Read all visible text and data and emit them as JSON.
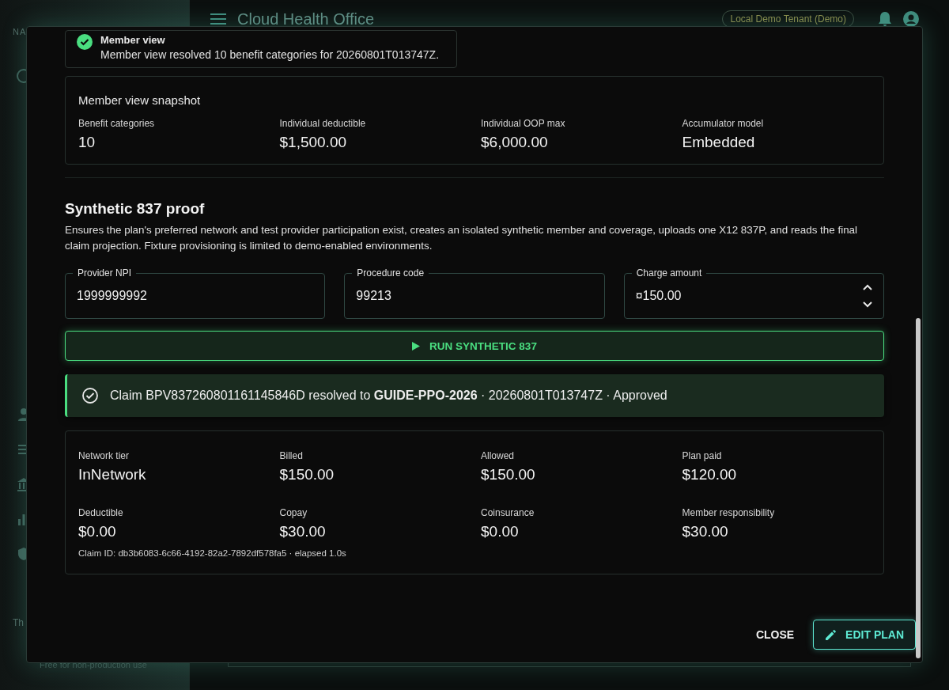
{
  "app": {
    "title": "Cloud Health Office",
    "tenant": "Local Demo Tenant (Demo)",
    "sidebar": {
      "heading": "NA",
      "theme_label": "Th",
      "footer": "Free for non-production use"
    }
  },
  "dialog": {
    "member_alert": {
      "title": "Member view",
      "message": "Member view resolved 10 benefit categories for 20260801T013747Z."
    },
    "snapshot": {
      "title": "Member view snapshot",
      "stats": [
        {
          "label": "Benefit categories",
          "value": "10"
        },
        {
          "label": "Individual deductible",
          "value": "$1,500.00"
        },
        {
          "label": "Individual OOP max",
          "value": "$6,000.00"
        },
        {
          "label": "Accumulator model",
          "value": "Embedded"
        }
      ]
    },
    "proof": {
      "title": "Synthetic 837 proof",
      "description": "Ensures the plan's preferred network and test provider participation exist, creates an isolated synthetic member and coverage, uploads one X12 837P, and reads the final claim projection. Fixture provisioning is limited to demo-enabled environments.",
      "fields": [
        {
          "label": "Provider NPI",
          "value": "1999999992",
          "kind": "text"
        },
        {
          "label": "Procedure code",
          "value": "99213",
          "kind": "text"
        },
        {
          "label": "Charge amount",
          "value": "¤150.00",
          "kind": "number"
        }
      ],
      "run_button": "RUN SYNTHETIC 837"
    },
    "result_alert": {
      "text": "Claim BPV837260801161145846D resolved to **GUIDE-PPO-2026** · 20260801T013747Z · Approved"
    },
    "result": {
      "stats": [
        {
          "label": "Network tier",
          "value": "InNetwork"
        },
        {
          "label": "Billed",
          "value": "$150.00"
        },
        {
          "label": "Allowed",
          "value": "$150.00"
        },
        {
          "label": "Plan paid",
          "value": "$120.00"
        },
        {
          "label": "Deductible",
          "value": "$0.00"
        },
        {
          "label": "Copay",
          "value": "$30.00"
        },
        {
          "label": "Coinsurance",
          "value": "$0.00"
        },
        {
          "label": "Member responsibility",
          "value": "$30.00"
        }
      ],
      "footnote": "Claim ID: db3b6083-6c66-4192-82a2-7892df578fa5 · elapsed 1.0s"
    },
    "actions": [
      {
        "label": "CLOSE",
        "kind": "text"
      },
      {
        "label": "EDIT PLAN",
        "kind": "outlined"
      }
    ]
  }
}
